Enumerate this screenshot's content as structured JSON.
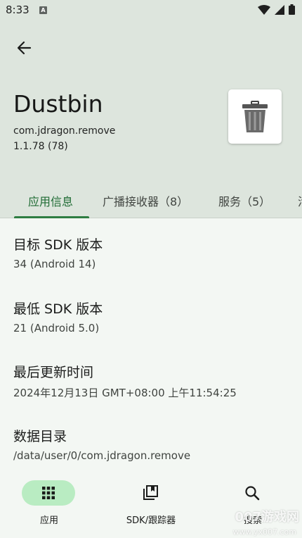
{
  "status_bar": {
    "time": "8:33",
    "badge": "A"
  },
  "app": {
    "name": "Dustbin",
    "package": "com.jdragon.remove",
    "version": "1.1.78 (78)"
  },
  "tabs": [
    {
      "label": "应用信息",
      "active": true
    },
    {
      "label": "广播接收器（8）",
      "active": false
    },
    {
      "label": "服务（5）",
      "active": false
    },
    {
      "label": "活",
      "active": false
    }
  ],
  "info": [
    {
      "label": "目标 SDK 版本",
      "value": "34 (Android 14)"
    },
    {
      "label": "最低 SDK 版本",
      "value": "21 (Android 5.0)"
    },
    {
      "label": "最后更新时间",
      "value": "2024年12月13日 GMT+08:00 上午11:54:25"
    },
    {
      "label": "数据目录",
      "value": "/data/user/0/com.jdragon.remove"
    }
  ],
  "bottom_nav": [
    {
      "label": "应用",
      "icon": "grid-icon",
      "active": true
    },
    {
      "label": "SDK/跟踪器",
      "icon": "library-icon",
      "active": false
    },
    {
      "label": "搜索",
      "icon": "search-icon",
      "active": false
    }
  ],
  "watermark": {
    "brand": "007游戏网",
    "url": "www.yx007.com"
  },
  "colors": {
    "header_bg": "#dde5dd",
    "body_bg": "#f3f7f3",
    "accent": "#2e7d42",
    "nav_active": "#b9ecc2"
  }
}
